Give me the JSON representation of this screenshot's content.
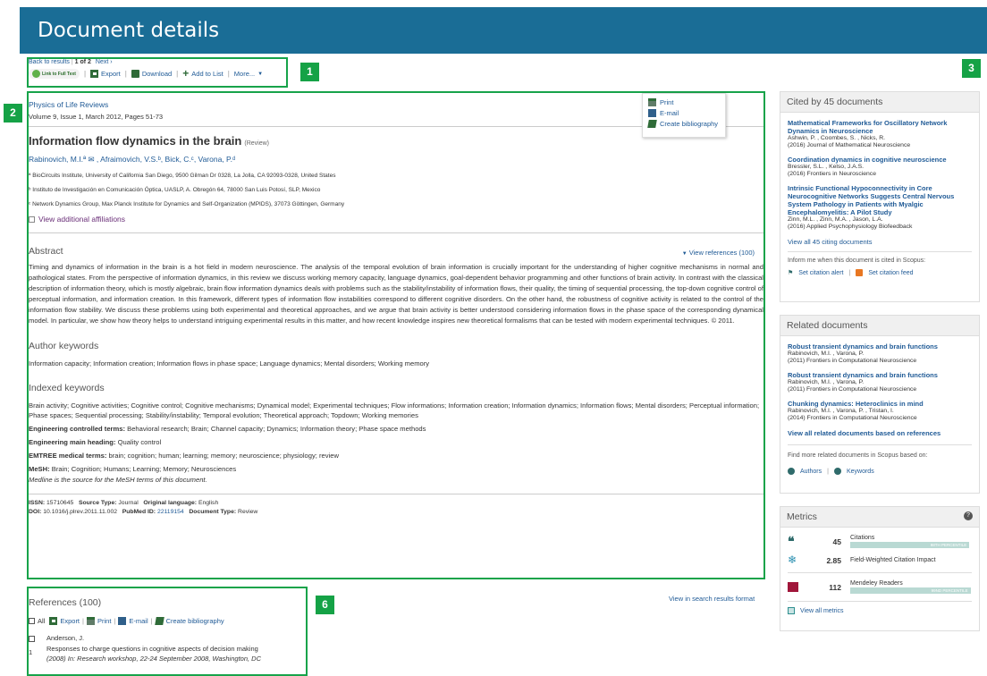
{
  "header": {
    "title": "Document details"
  },
  "callouts": {
    "c1": "1",
    "c2": "2",
    "c3": "3",
    "c6": "6"
  },
  "nav": {
    "back": "Back to results",
    "count": "1 of 2",
    "next": "Next ›"
  },
  "toolbar": {
    "fulltext": "Link to Full Text",
    "export": "Export",
    "download": "Download",
    "addlist": "Add to List",
    "more": "More..."
  },
  "popup": {
    "print": "Print",
    "email": "E-mail",
    "bib": "Create bibliography"
  },
  "doc": {
    "journal": "Physics of Life Reviews",
    "volume": "Volume 9, Issue 1, March 2012, Pages 51-73",
    "title": "Information flow dynamics in the brain",
    "type": "(Review)",
    "authors": "Rabinovich, M.I.ª ✉ ,  Afraimovich, V.S.ᵇ,  Bick, C.ᶜ,  Varona, P.ᵈ",
    "affiliations": [
      "ª  BioCircuits Institute, University of California San Diego, 9500 Gilman Dr 0328, La Jolla, CA 92093-0328, United States",
      "ᵇ  Instituto de Investigación en Comunicación Óptica, UASLP, A. Obregón 64, 78000 San Luis Potosí, SLP, Mexico",
      "ᶜ  Network Dynamics Group, Max Planck Institute for Dynamics and Self-Organization (MPIDS), 37073 Göttingen, Germany"
    ],
    "view_affil": "View additional affiliations",
    "view_refs": "View references (100)"
  },
  "abstract": {
    "heading": "Abstract",
    "text": "Timing and dynamics of information in the brain is a hot field in modern neuroscience. The analysis of the temporal evolution of brain information is crucially important for the understanding of higher cognitive mechanisms in normal and pathological states. From the perspective of information dynamics, in this review we discuss working memory capacity, language dynamics, goal-dependent behavior programming and other functions of brain activity. In contrast with the classical description of information theory, which is mostly algebraic, brain flow information dynamics deals with problems such as the stability/instability of information flows, their quality, the timing of sequential processing, the top-down cognitive control of perceptual information, and information creation. In this framework, different types of information flow instabilities correspond to different cognitive disorders. On the other hand, the robustness of cognitive activity is related to the control of the information flow stability. We discuss these problems using both experimental and theoretical approaches, and we argue that brain activity is better understood considering information flows in the phase space of the corresponding dynamical model. In particular, we show how theory helps to understand intriguing experimental results in this matter, and how recent knowledge inspires new theoretical formalisms that can be tested with modern experimental techniques. © 2011."
  },
  "author_kw": {
    "heading": "Author keywords",
    "text": "Information capacity; Information creation; Information flows in phase space; Language dynamics; Mental disorders; Working memory"
  },
  "indexed_kw": {
    "heading": "Indexed keywords",
    "brain_activity": "Brain activity; Cognitive activities; Cognitive control; Cognitive mechanisms; Dynamical model; Experimental techniques; Flow informations; Information creation; Information dynamics; Information flows; Mental disorders; Perceptual information; Phase spaces; Sequential processing; Stability/instability; Temporal evolution; Theoretical approach; Topdown; Working memories",
    "ect_label": "Engineering controlled terms:",
    "ect": "Behavioral research; Brain; Channel capacity; Dynamics; Information theory; Phase space methods",
    "emh_label": "Engineering main heading:",
    "emh": "Quality control",
    "emtree_label": "EMTREE medical terms:",
    "emtree": "brain; cognition; human; learning; memory; neuroscience; physiology; review",
    "mesh_label": "MeSH:",
    "mesh": "Brain; Cognition; Humans; Learning; Memory; Neurosciences",
    "medline": "Medline is the source for the MeSH terms of this document."
  },
  "meta": {
    "issn_label": "ISSN:",
    "issn": "15710645",
    "source_label": "Source Type:",
    "source": "Journal",
    "lang_label": "Original language:",
    "lang": "English",
    "doi_label": "DOI:",
    "doi": "10.1016/j.plrev.2011.11.002",
    "pubmed_label": "PubMed ID:",
    "pubmed": "22119154",
    "doctype_label": "Document Type:",
    "doctype": "Review"
  },
  "cited": {
    "heading": "Cited by 45 documents",
    "items": [
      {
        "title": "Mathematical Frameworks for Oscillatory Network Dynamics in Neuroscience",
        "authors": "Ashwin, P. , Coombes, S. , Nicks, R.",
        "journal": "(2016) Journal of Mathematical Neuroscience"
      },
      {
        "title": "Coordination dynamics in cognitive neuroscience",
        "authors": "Bressler, S.L. , Kelso, J.A.S.",
        "journal": "(2016) Frontiers in Neuroscience"
      },
      {
        "title": "Intrinsic Functional Hypoconnectivity in Core Neurocognitive Networks Suggests Central Nervous System Pathology in Patients with Myalgic Encephalomyelitis: A Pilot Study",
        "authors": "Zinn, M.L. , Zinn, M.A. , Jason, L.A.",
        "journal": "(2016) Applied Psychophysiology Biofeedback"
      }
    ],
    "view_all": "View all 45 citing documents",
    "inform": "Inform me when this document is cited in Scopus:",
    "alert": "Set citation alert",
    "feed": "Set citation feed"
  },
  "related": {
    "heading": "Related documents",
    "items": [
      {
        "title": "Robust transient dynamics and brain functions",
        "authors": "Rabinovich, M.I. , Varona, P.",
        "journal": "(2011) Frontiers in Computational Neuroscience"
      },
      {
        "title": "Robust transient dynamics and brain functions",
        "authors": "Rabinovich, M.I. , Varona, P.",
        "journal": "(2011) Frontiers in Computational Neuroscience"
      },
      {
        "title": "Chunking dynamics: Heteroclinics in mind",
        "authors": "Rabinovich, M.I. , Varona, P. , Tristan, I.",
        "journal": "(2014) Frontiers in Computational Neuroscience"
      }
    ],
    "view_all": "View all related documents based on references",
    "find_more": "Find more related documents in Scopus based on:",
    "authors_btn": "Authors",
    "keywords_btn": "Keywords"
  },
  "metrics": {
    "heading": "Metrics",
    "help": "?",
    "rows": [
      {
        "value": "45",
        "label": "Citations",
        "pct_label": "98TH PERCENTILE",
        "pct": 98
      },
      {
        "value": "2.85",
        "label": "Field-Weighted Citation Impact",
        "pct_label": "",
        "pct": 0
      },
      {
        "value": "112",
        "label": "Mendeley Readers",
        "pct_label": "99ND PERCENTILE",
        "pct": 99
      }
    ],
    "view_all": "View all metrics"
  },
  "refs": {
    "heading": "References (100)",
    "all": "All",
    "export": "Export",
    "print": "Print",
    "email": "E-mail",
    "bib": "Create bibliography",
    "view_search": "View in search results format",
    "first": {
      "num": "1",
      "author": "Anderson, J.",
      "title": "Responses to charge questions in cognitive aspects of decision making",
      "source": "(2008) In: Research workshop, 22-24 September 2008, Washington, DC"
    }
  },
  "colors": {
    "header": "#1a6d96",
    "callout": "#15a246",
    "link": "#1f5a96"
  }
}
